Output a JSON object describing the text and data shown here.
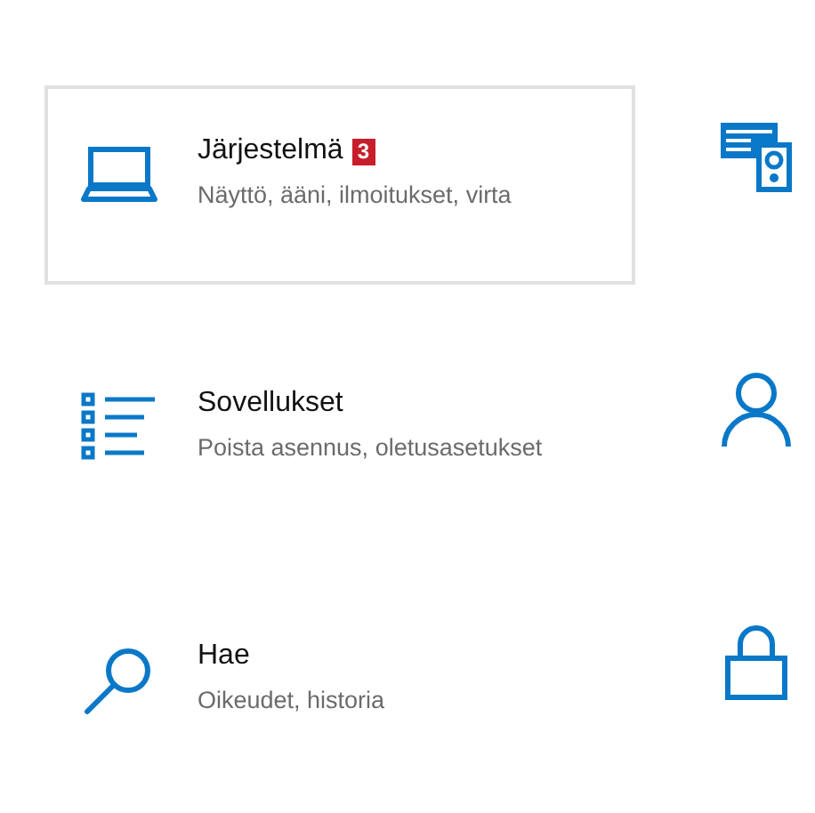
{
  "tiles": [
    {
      "title": "Järjestelmä",
      "badge": "3",
      "subtitle": "Näyttö, ääni, ilmoitukset, virta",
      "selected": true
    },
    {
      "title": "Sovellukset",
      "subtitle": "Poista asennus, oletusasetukset",
      "selected": false
    },
    {
      "title": "Hae",
      "subtitle": "Oikeudet, historia",
      "selected": false
    }
  ]
}
